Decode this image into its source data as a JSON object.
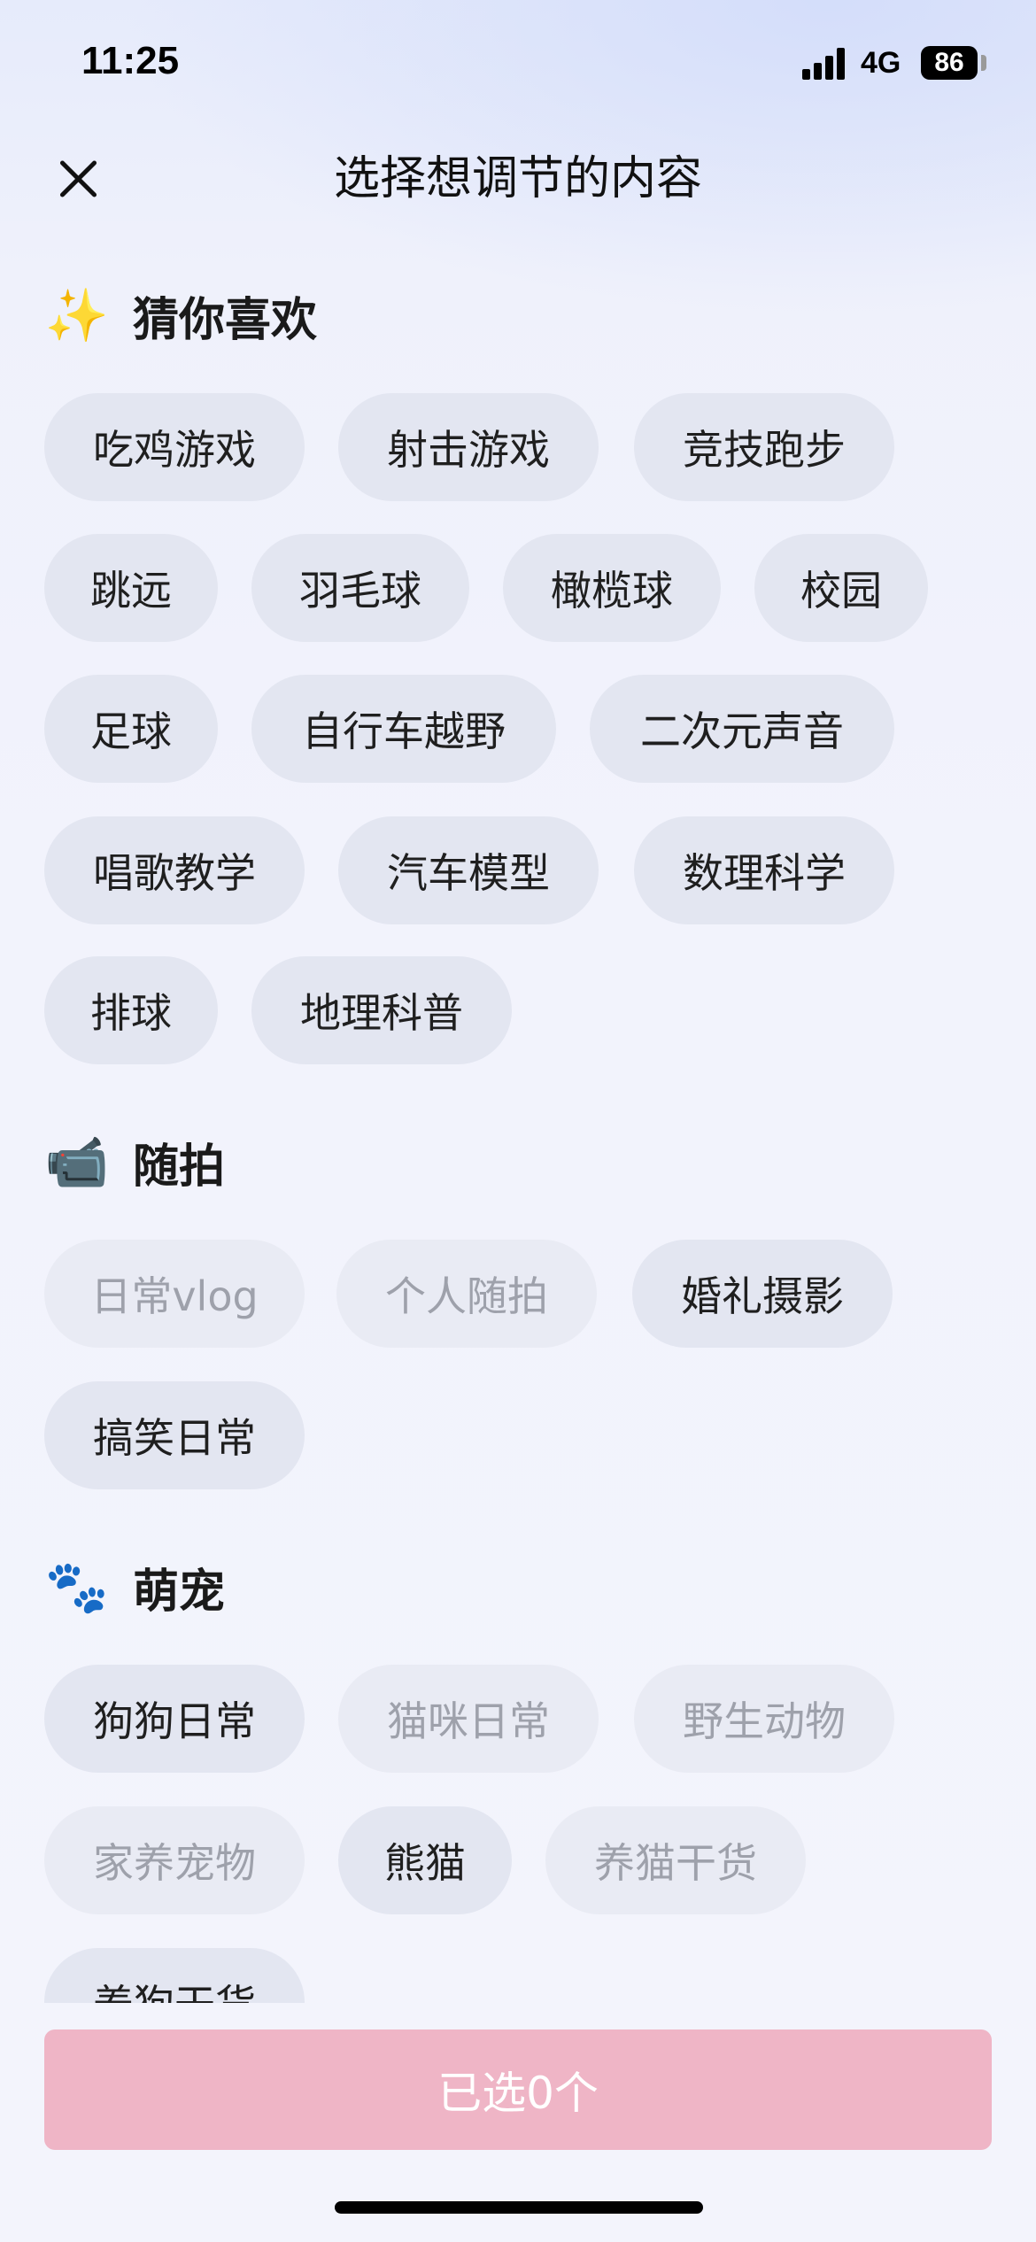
{
  "status_bar": {
    "time": "11:25",
    "network": "4G",
    "battery": "86"
  },
  "header": {
    "title": "选择想调节的内容",
    "close_icon": "close-icon"
  },
  "sections": [
    {
      "emoji": "✨",
      "title": "猜你喜欢",
      "chips": [
        {
          "label": "吃鸡游戏",
          "selectable": true
        },
        {
          "label": "射击游戏",
          "selectable": true
        },
        {
          "label": "竞技跑步",
          "selectable": true
        },
        {
          "label": "跳远",
          "selectable": true
        },
        {
          "label": "羽毛球",
          "selectable": true
        },
        {
          "label": "橄榄球",
          "selectable": true
        },
        {
          "label": "校园",
          "selectable": true
        },
        {
          "label": "足球",
          "selectable": true
        },
        {
          "label": "自行车越野",
          "selectable": true
        },
        {
          "label": "二次元声音",
          "selectable": true
        },
        {
          "label": "唱歌教学",
          "selectable": true
        },
        {
          "label": "汽车模型",
          "selectable": true
        },
        {
          "label": "数理科学",
          "selectable": true
        },
        {
          "label": "排球",
          "selectable": true
        },
        {
          "label": "地理科普",
          "selectable": true
        }
      ]
    },
    {
      "emoji": "📹",
      "title": "随拍",
      "chips": [
        {
          "label": "日常vlog",
          "selectable": false
        },
        {
          "label": "个人随拍",
          "selectable": false
        },
        {
          "label": "婚礼摄影",
          "selectable": true
        },
        {
          "label": "搞笑日常",
          "selectable": true
        }
      ]
    },
    {
      "emoji": "🐾",
      "title": "萌宠",
      "chips": [
        {
          "label": "狗狗日常",
          "selectable": true
        },
        {
          "label": "猫咪日常",
          "selectable": false
        },
        {
          "label": "野生动物",
          "selectable": false
        },
        {
          "label": "家养宠物",
          "selectable": false
        },
        {
          "label": "熊猫",
          "selectable": true
        },
        {
          "label": "养猫干货",
          "selectable": false
        },
        {
          "label": "养狗干货",
          "selectable": true
        }
      ]
    }
  ],
  "footer": {
    "confirm_label": "已选0个"
  },
  "colors": {
    "chip_bg": "#e3e6f1",
    "chip_dim_text": "#9ea1ab",
    "confirm_bg": "#efb5c6"
  }
}
